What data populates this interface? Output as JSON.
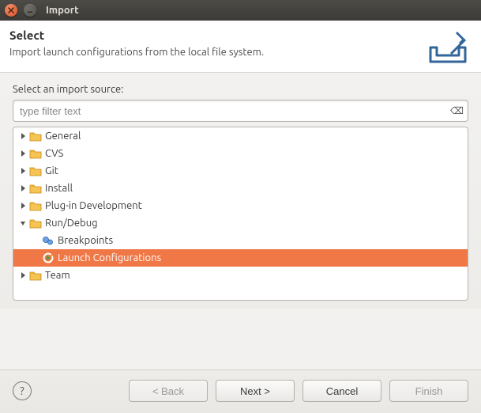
{
  "window": {
    "title": "Import"
  },
  "header": {
    "title": "Select",
    "subtitle": "Import launch configurations from the local file system."
  },
  "body": {
    "source_label": "Select an import source:",
    "filter_placeholder": "type filter text"
  },
  "tree": [
    {
      "label": "General",
      "expanded": false,
      "kind": "folder"
    },
    {
      "label": "CVS",
      "expanded": false,
      "kind": "folder"
    },
    {
      "label": "Git",
      "expanded": false,
      "kind": "folder"
    },
    {
      "label": "Install",
      "expanded": false,
      "kind": "folder"
    },
    {
      "label": "Plug-in Development",
      "expanded": false,
      "kind": "folder"
    },
    {
      "label": "Run/Debug",
      "expanded": true,
      "kind": "folder",
      "children": [
        {
          "label": "Breakpoints",
          "kind": "breakpoints",
          "selected": false
        },
        {
          "label": "Launch Configurations",
          "kind": "launch",
          "selected": true
        }
      ]
    },
    {
      "label": "Team",
      "expanded": false,
      "kind": "folder"
    }
  ],
  "footer": {
    "back": "< Back",
    "next": "Next >",
    "cancel": "Cancel",
    "finish": "Finish",
    "back_enabled": false,
    "next_enabled": true,
    "cancel_enabled": true,
    "finish_enabled": false
  }
}
